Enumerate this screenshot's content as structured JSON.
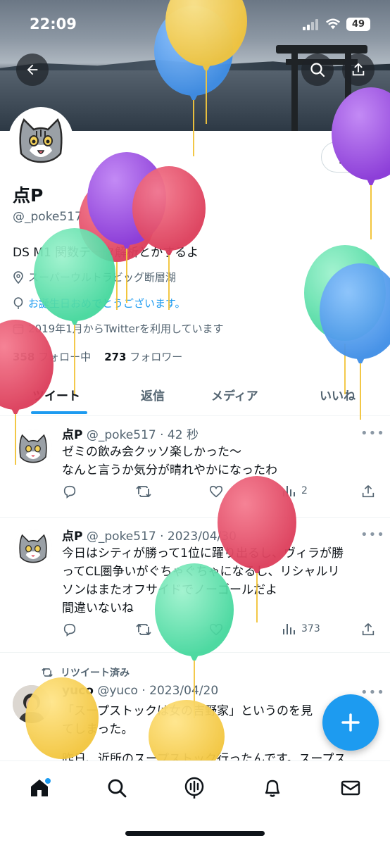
{
  "status": {
    "time": "22:09",
    "battery": "49"
  },
  "profile": {
    "name": "点P",
    "handle": "@_poke517",
    "bio": "DS M1 関数データ解析とかするよ",
    "location": "スーパーウルトラビッグ断層湖",
    "birthday_message": "お誕生日おめでとうございます。",
    "joined": "2019年1月からTwitterを利用しています",
    "following_count": "358",
    "following_label": "フォロー中",
    "followers_count": "273",
    "followers_label": "フォロワー",
    "edit_label": "編集"
  },
  "tabs": [
    "ツイート",
    "返信",
    "メディア",
    "いいね"
  ],
  "tweets": [
    {
      "name": "点P",
      "meta": "@_poke517 · 42 秒",
      "lines": [
        "ゼミの飲み会クッソ楽しかった〜",
        "なんと言うか気分が晴れやかになったわ"
      ],
      "views": "2"
    },
    {
      "name": "点P",
      "meta": "@_poke517 · 2023/04/30",
      "lines": [
        "今日はシティが勝って1位に躍り出るし、ヴィラが勝",
        "ってCL圏争いがぐちゃぐちゃになるし、リシャルリ",
        "ソンはまたオフサイドでノーゴールだよ",
        "間違いないね"
      ],
      "views": "373"
    },
    {
      "retweet_label": "リツイート済み",
      "name": "yuco",
      "meta": "@yuco · 2023/04/20",
      "lines": [
        "「スープストックは女の吉野家」というのを見",
        "てしまった。",
        "",
        "昨日、近所のスープストック行ったんです。スープス"
      ]
    }
  ],
  "icons": {
    "back": "arrow-left-icon",
    "search": "search-icon",
    "share": "share-icon",
    "reply": "reply-icon",
    "retweet": "retweet-icon",
    "like": "heart-icon",
    "views": "views-icon",
    "compose": "plus-icon",
    "home": "home-icon",
    "explore": "search-icon",
    "spaces": "microphone-icon",
    "notifications": "bell-icon",
    "messages": "mail-icon"
  },
  "colors": {
    "accent": "#1d9bf0",
    "text": "#0f1419",
    "secondary": "#536471"
  }
}
